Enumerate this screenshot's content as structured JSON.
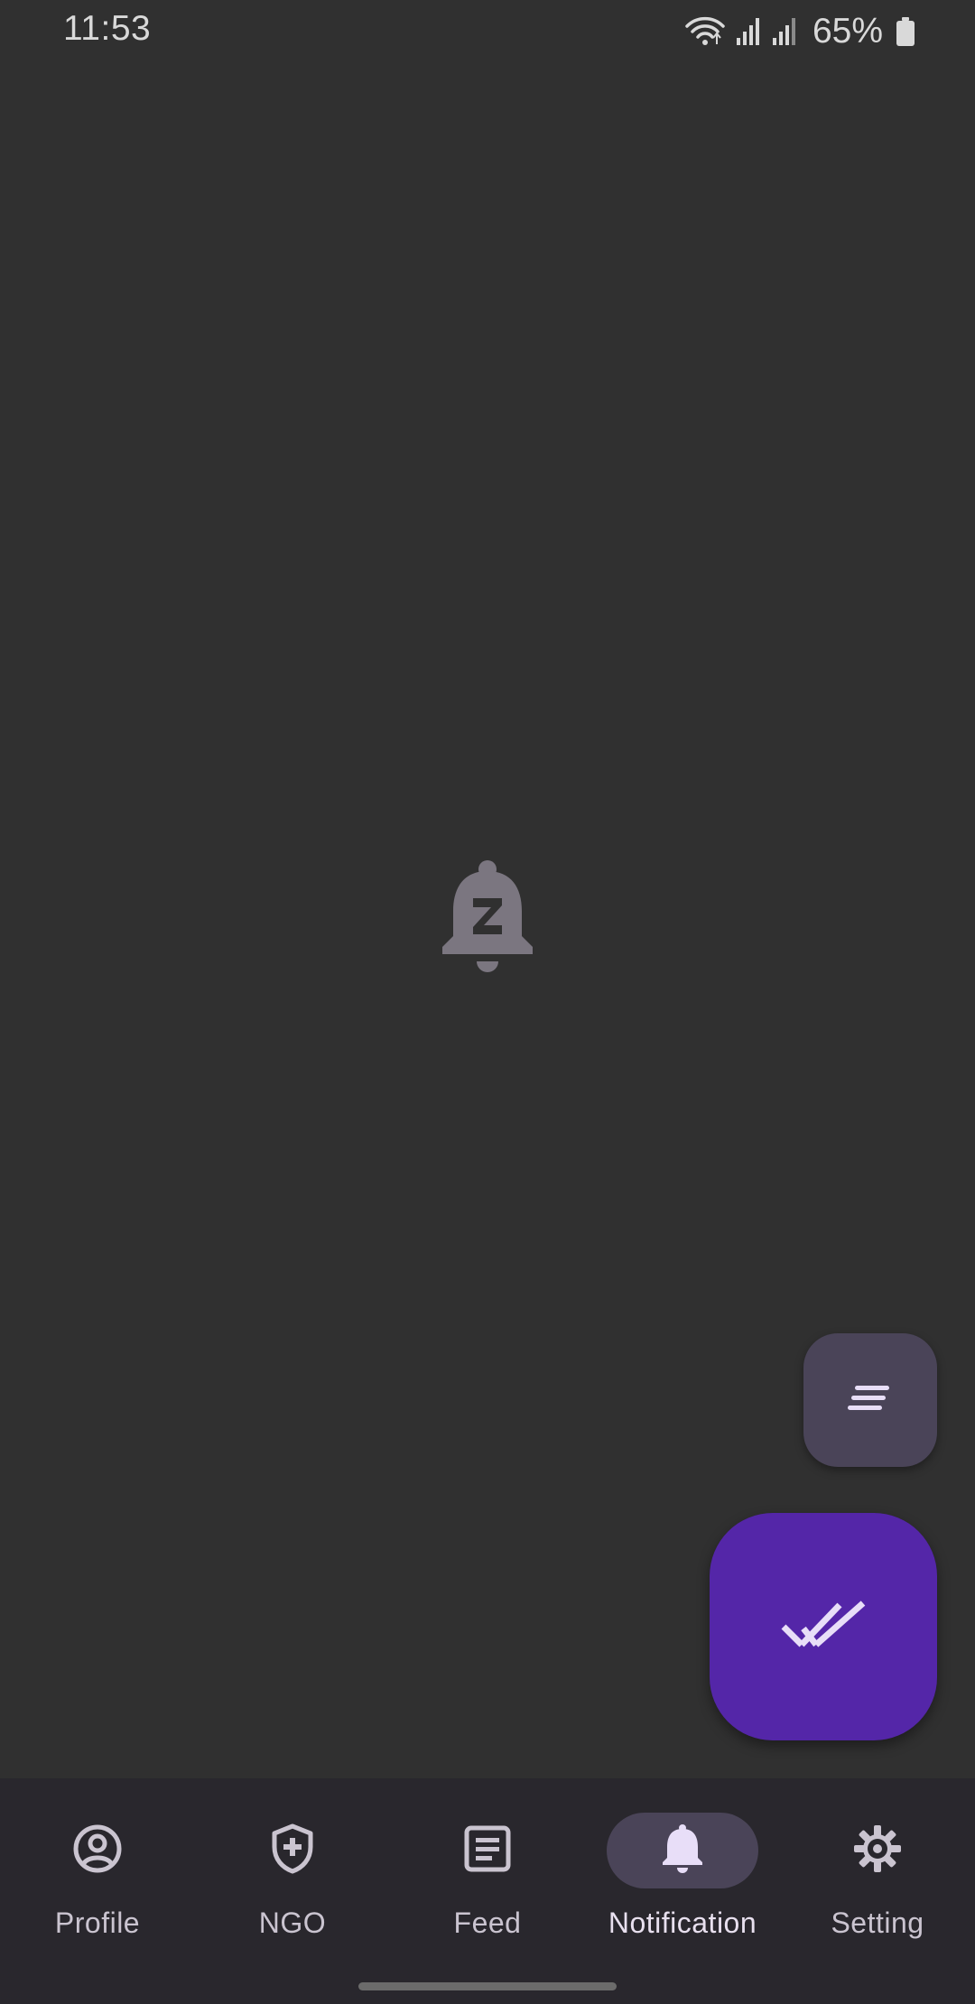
{
  "status_bar": {
    "time": "11:53",
    "battery": "65%"
  },
  "empty_state": {
    "icon": "notifications-paused-icon"
  },
  "fabs": {
    "small": {
      "icon": "sort-lines-icon"
    },
    "large": {
      "icon": "done-all-icon"
    }
  },
  "bottom_nav": {
    "items": [
      {
        "label": "Profile",
        "icon": "account-circle-icon",
        "active": false
      },
      {
        "label": "NGO",
        "icon": "shield-plus-icon",
        "active": false
      },
      {
        "label": "Feed",
        "icon": "article-icon",
        "active": false
      },
      {
        "label": "Notification",
        "icon": "bell-icon",
        "active": true
      },
      {
        "label": "Setting",
        "icon": "gear-icon",
        "active": false
      }
    ]
  },
  "colors": {
    "background": "#303030",
    "nav_background": "#29272d",
    "active_pill": "#4a4458",
    "primary_fab": "#5426a8",
    "secondary_fab": "#4a4458",
    "icon_muted": "#cac4d0"
  }
}
